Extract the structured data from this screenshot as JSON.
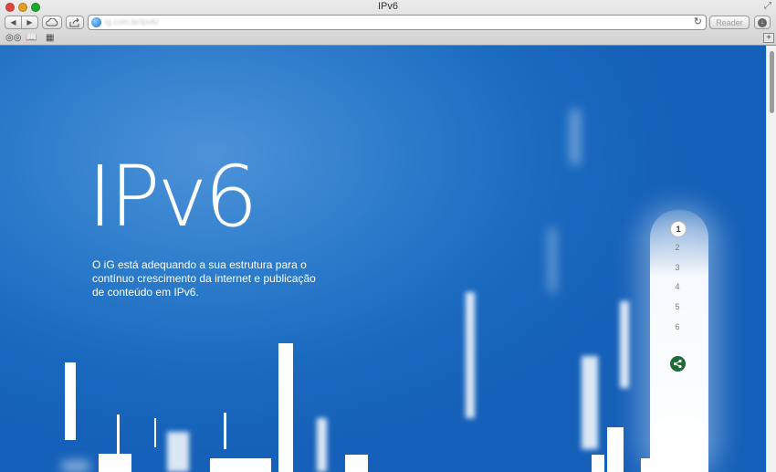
{
  "window": {
    "title": "IPv6"
  },
  "toolbar": {
    "back_icon": "◀",
    "forward_icon": "▶",
    "url": "ig.com.br/ipv6/",
    "reader_label": "Reader"
  },
  "page": {
    "title": "IPv6",
    "description": "O iG está adequando a sua estrutura para o contínuo crescimento da internet e publicação de conteúdo em IPv6.",
    "pager": [
      "1",
      "2",
      "3",
      "4",
      "5",
      "6"
    ],
    "active_page": "1"
  },
  "colors": {
    "background": "#1a6ac0",
    "share_button": "#1d6b35"
  }
}
